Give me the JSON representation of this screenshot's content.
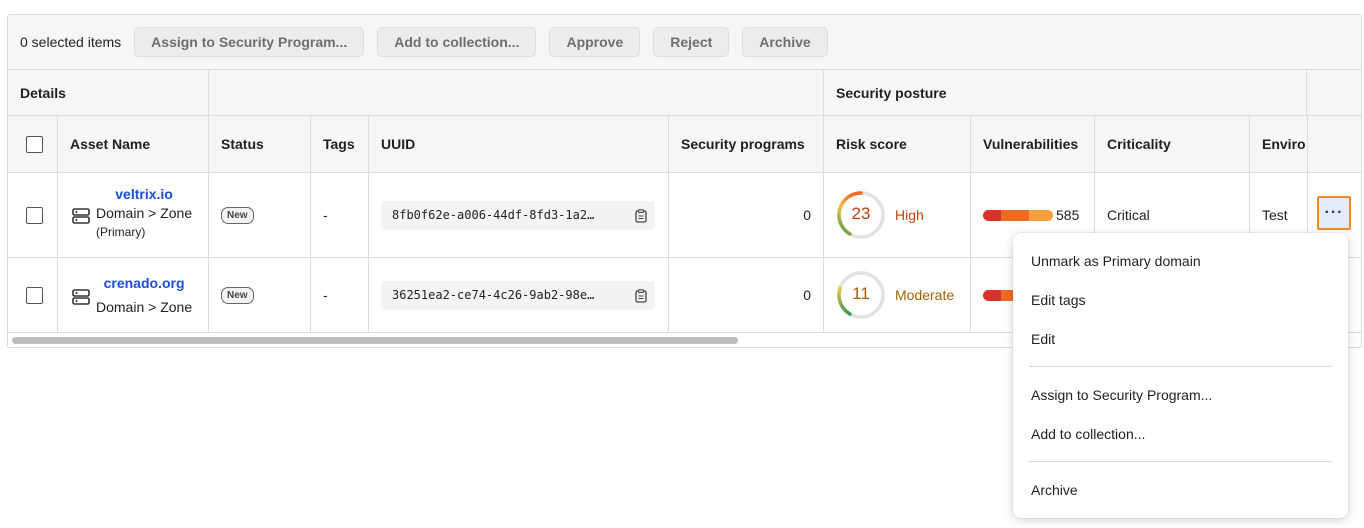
{
  "toolbar": {
    "selected_count": "0 selected items",
    "assign_label": "Assign to Security Program...",
    "collection_label": "Add to collection...",
    "approve_label": "Approve",
    "reject_label": "Reject",
    "archive_label": "Archive"
  },
  "groups": {
    "details": "Details",
    "security_posture": "Security posture"
  },
  "columns": {
    "asset_name": "Asset Name",
    "status": "Status",
    "tags": "Tags",
    "uuid": "UUID",
    "security_programs": "Security programs",
    "risk_score": "Risk score",
    "vulnerabilities": "Vulnerabilities",
    "criticality": "Criticality",
    "environment": "Enviro"
  },
  "rows": [
    {
      "name": "veltrix.io",
      "type": "Domain > Zone",
      "sub": "(Primary)",
      "status": "New",
      "tags": "-",
      "uuid": "8fb0f62e-a006-44df-8fd3-1a2…",
      "programs": "0",
      "risk": "23",
      "risk_level": "High",
      "risk_color": "#c2410c",
      "risk_fraction": 0.23,
      "vulns": "585",
      "criticality": "Critical",
      "environment": "Test"
    },
    {
      "name": "crenado.org",
      "type": "Domain > Zone",
      "sub": "",
      "status": "New",
      "tags": "-",
      "uuid": "36251ea2-ce74-4c26-9ab2-98e…",
      "programs": "0",
      "risk": "11",
      "risk_level": "Moderate",
      "risk_color": "#a16207",
      "risk_fraction": 0.11,
      "vulns": "",
      "criticality": "",
      "environment": ""
    }
  ],
  "menu_button": "···",
  "context_menu": {
    "unmark_primary": "Unmark as Primary domain",
    "edit_tags": "Edit tags",
    "edit": "Edit",
    "assign": "Assign to Security Program...",
    "add_collection": "Add to collection...",
    "archive": "Archive"
  },
  "colors": {
    "link": "#1a4fd8",
    "accent_focus": "#f08a24",
    "vuln_critical": "#d9312b",
    "vuln_high": "#f06a22",
    "vuln_medium": "#f5a03c",
    "vuln_low": "#f2c04a",
    "gauge_green": "#3a9a4a"
  },
  "icons": {
    "row_type": "server-icon",
    "copy": "clipboard-icon"
  }
}
